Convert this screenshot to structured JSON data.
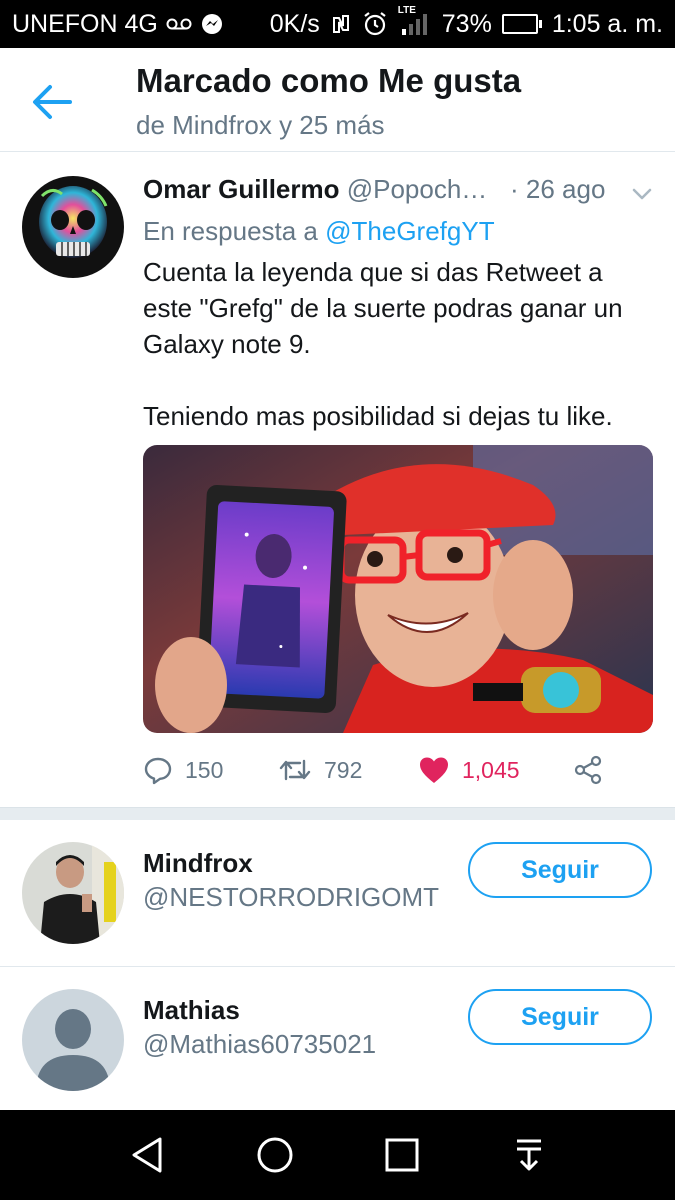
{
  "status_bar": {
    "carrier": "UNEFON 4G",
    "speed": "0K/s",
    "network_badge": "LTE",
    "battery_percent": "73%",
    "battery_level": 0.73,
    "time": "1:05 a. m."
  },
  "header": {
    "title": "Marcado como Me gusta",
    "subtitle": "de Mindfrox y 25 más"
  },
  "tweet": {
    "author_name": "Omar Guillermo",
    "author_handle": "@Popoch…",
    "time": "· 26 ago",
    "reply_prefix": "En respuesta a",
    "reply_mention": "@TheGrefgYT",
    "text_paragraph_1": "Cuenta la leyenda que si das Retweet a este \"Grefg\" de la suerte podras ganar un Galaxy note 9.",
    "text_paragraph_2": "Teniendo mas posibilidad si dejas tu like.",
    "stats": {
      "replies": "150",
      "retweets": "792",
      "likes": "1,045"
    }
  },
  "users": [
    {
      "name": "Mindfrox",
      "handle": "@NESTORRODRIGOMT",
      "follow_label": "Seguir"
    },
    {
      "name": "Mathias",
      "handle": "@Mathias60735021",
      "follow_label": "Seguir"
    }
  ],
  "colors": {
    "accent": "#1da1f2",
    "like": "#e0245e",
    "secondary_text": "#657786"
  }
}
